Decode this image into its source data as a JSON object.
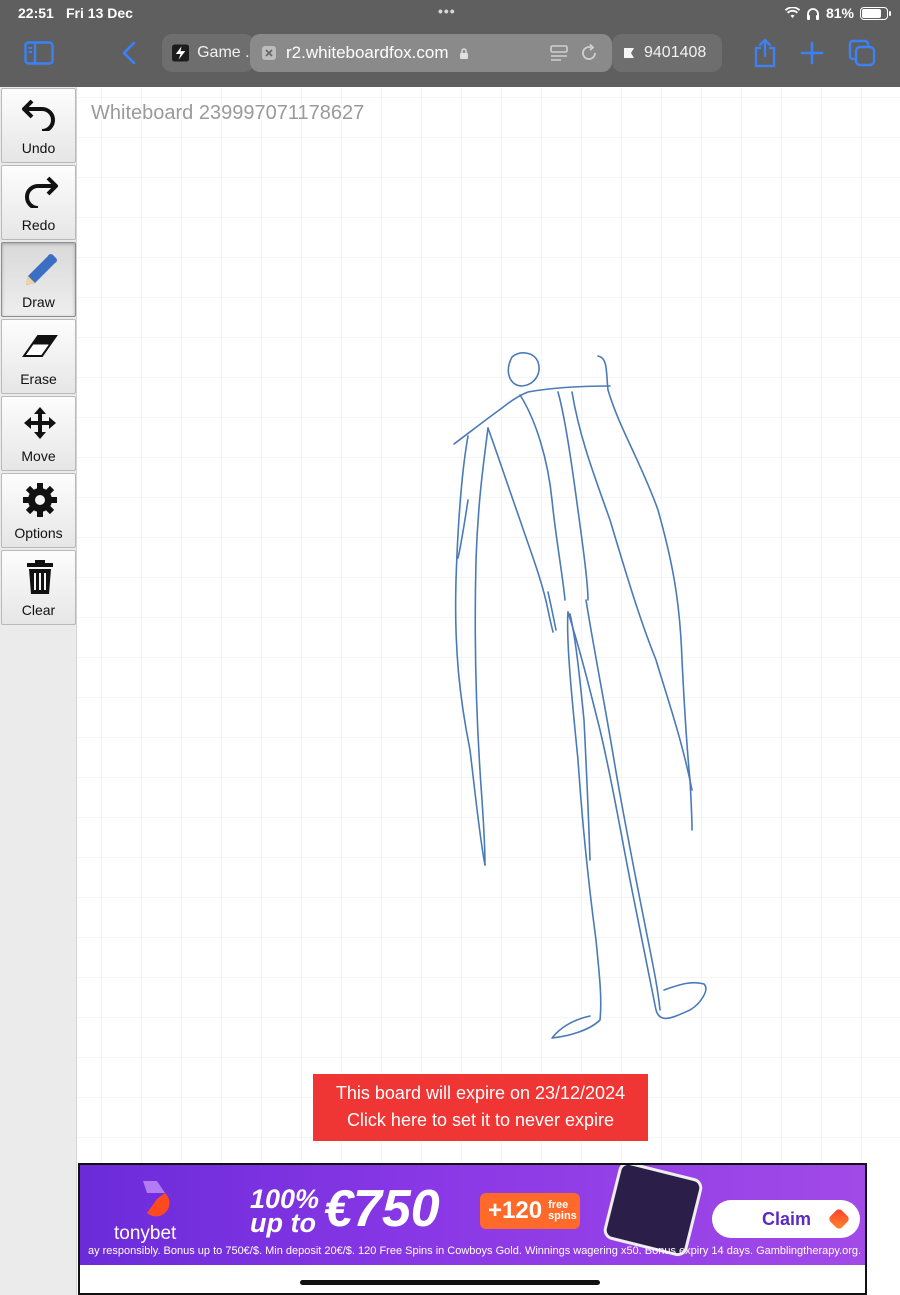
{
  "status_bar": {
    "time": "22:51",
    "date": "Fri 13 Dec",
    "battery": "81%"
  },
  "browser": {
    "tabs": [
      {
        "label": "Game ..",
        "icon": "lightning-icon"
      },
      {
        "label": "r2.whiteboardfox.com",
        "icon": "close-icon",
        "active": true
      },
      {
        "label": "9401408",
        "icon": "flag-icon"
      }
    ],
    "accent_color": "#3b82f6"
  },
  "palette": {
    "tools": [
      {
        "label": "Undo",
        "icon": "undo-icon"
      },
      {
        "label": "Redo",
        "icon": "redo-icon"
      },
      {
        "label": "Draw",
        "icon": "pencil-icon",
        "active": true
      },
      {
        "label": "Erase",
        "icon": "eraser-icon"
      },
      {
        "label": "Move",
        "icon": "move-icon"
      },
      {
        "label": "Options",
        "icon": "gear-icon"
      },
      {
        "label": "Clear",
        "icon": "trash-icon"
      }
    ]
  },
  "board": {
    "title": "Whiteboard 239997071178627",
    "stroke_color": "#4a7ab8"
  },
  "expiry": {
    "line1": "This board will expire on 23/12/2024",
    "line2": "Click here to set it to never expire",
    "color": "#f03535"
  },
  "ad": {
    "brand": "tonybet",
    "line1a": "100%",
    "line1b": "up to",
    "amount": "€750",
    "spins_number": "+120",
    "spins_text_1": "free",
    "spins_text_2": "spins",
    "claim": "Claim",
    "disclaimer": "ay responsibly. Bonus up to 750€/$. Min deposit 20€/$. 120 Free Spins in Cowboys Gold. Winnings wagering x50. Bonus expiry 14 days. Gamblingtherapy.org."
  }
}
